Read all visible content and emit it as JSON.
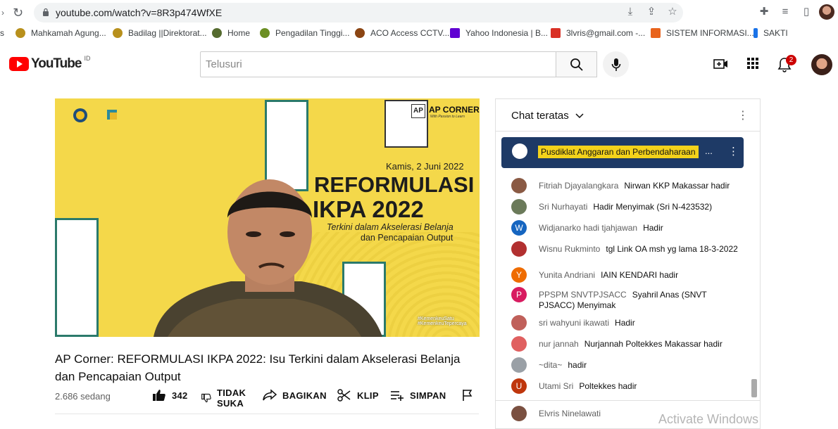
{
  "browser": {
    "url": "youtube.com/watch?v=8R3p474WfXE",
    "bookmarks": [
      {
        "label": "Mahkamah Agung...",
        "color": "#b8901c"
      },
      {
        "label": "Badilag ||Direktorat...",
        "color": "#b8901c"
      },
      {
        "label": "Home",
        "color": "#556b2f"
      },
      {
        "label": "Pengadilan Tinggi...",
        "color": "#6b8e23"
      },
      {
        "label": "ACO Access CCTV...",
        "color": "#8b4513"
      },
      {
        "label": "Yahoo Indonesia | B...",
        "color": "#6001d2"
      },
      {
        "label": "3lvris@gmail.com -...",
        "color": "#d93025"
      },
      {
        "label": "SISTEM INFORMASI...",
        "color": "#e8631c"
      },
      {
        "label": "SAKTI",
        "color": "#1a73e8"
      }
    ],
    "left_cut_label": "s"
  },
  "header": {
    "logo_text": "YouTube",
    "country": "ID",
    "search_placeholder": "Telusuri",
    "notification_count": "2"
  },
  "video": {
    "overlay_date": "Kamis, 2 Juni 2022",
    "overlay_title1": "REFORMULASI",
    "overlay_title2": "IKPA 2022",
    "overlay_sub1": "Terkini dalam Akselerasi Belanja",
    "overlay_sub2": "dan Pencapaian Output",
    "brand": "AP CORNER",
    "brand_tag": "With Passion to Learn",
    "brand_box": "AP",
    "hashtags": "#KemenkeuSatu  #KemenkeuTepercaya",
    "title": "AP Corner: REFORMULASI IKPA 2022: Isu Terkini dalam Akselerasi Belanja dan Pencapaian Output",
    "views": "2.686 sedang"
  },
  "actions": {
    "like_count": "342",
    "dislike_label_1": "TIDAK",
    "dislike_label_2": "SUKA",
    "share": "BAGIKAN",
    "clip": "KLIP",
    "save": "SIMPAN"
  },
  "chat": {
    "title": "Chat teratas",
    "pinned": "Pusdiklat Anggaran dan Perbendaharaan",
    "pinned_more": "...",
    "messages": [
      {
        "author": "Fitriah Djayalangkara",
        "text": "Nirwan KKP Makassar hadir",
        "avatar": "",
        "color": "#8a5a44"
      },
      {
        "author": "Sri Nurhayati",
        "text": "Hadir Menyimak (Sri N-423532)",
        "avatar": "",
        "color": "#6b7a5a"
      },
      {
        "author": "Widjanarko hadi tjahjawan",
        "text": "Hadir",
        "avatar": "W",
        "color": "#1565c0"
      },
      {
        "author": "Wisnu Rukminto",
        "text": "tgl Link OA msh yg lama 18-3-2022",
        "avatar": "",
        "color": "#b23030"
      },
      {
        "author": "Yunita Andriani",
        "text": "IAIN KENDARI hadir",
        "avatar": "Y",
        "color": "#ef6c00"
      },
      {
        "author": "PPSPM SNVTPJSACC",
        "text": "Syahril Anas (SNVT PJSACC) Menyimak",
        "avatar": "P",
        "color": "#d81b60"
      },
      {
        "author": "sri wahyuni ikawati",
        "text": "Hadir",
        "avatar": "",
        "color": "#c0605a"
      },
      {
        "author": "nur jannah",
        "text": "Nurjannah Poltekkes Makassar hadir",
        "avatar": "",
        "color": "#e06060"
      },
      {
        "author": "~dita~",
        "text": "hadir",
        "avatar": "",
        "color": "#9aa0a6"
      },
      {
        "author": "Utami Sri",
        "text": "Poltekkes hadir",
        "avatar": "U",
        "color": "#bf360c"
      }
    ],
    "last_author": "Elvris Ninelawati"
  },
  "watermark": "Activate Windows"
}
